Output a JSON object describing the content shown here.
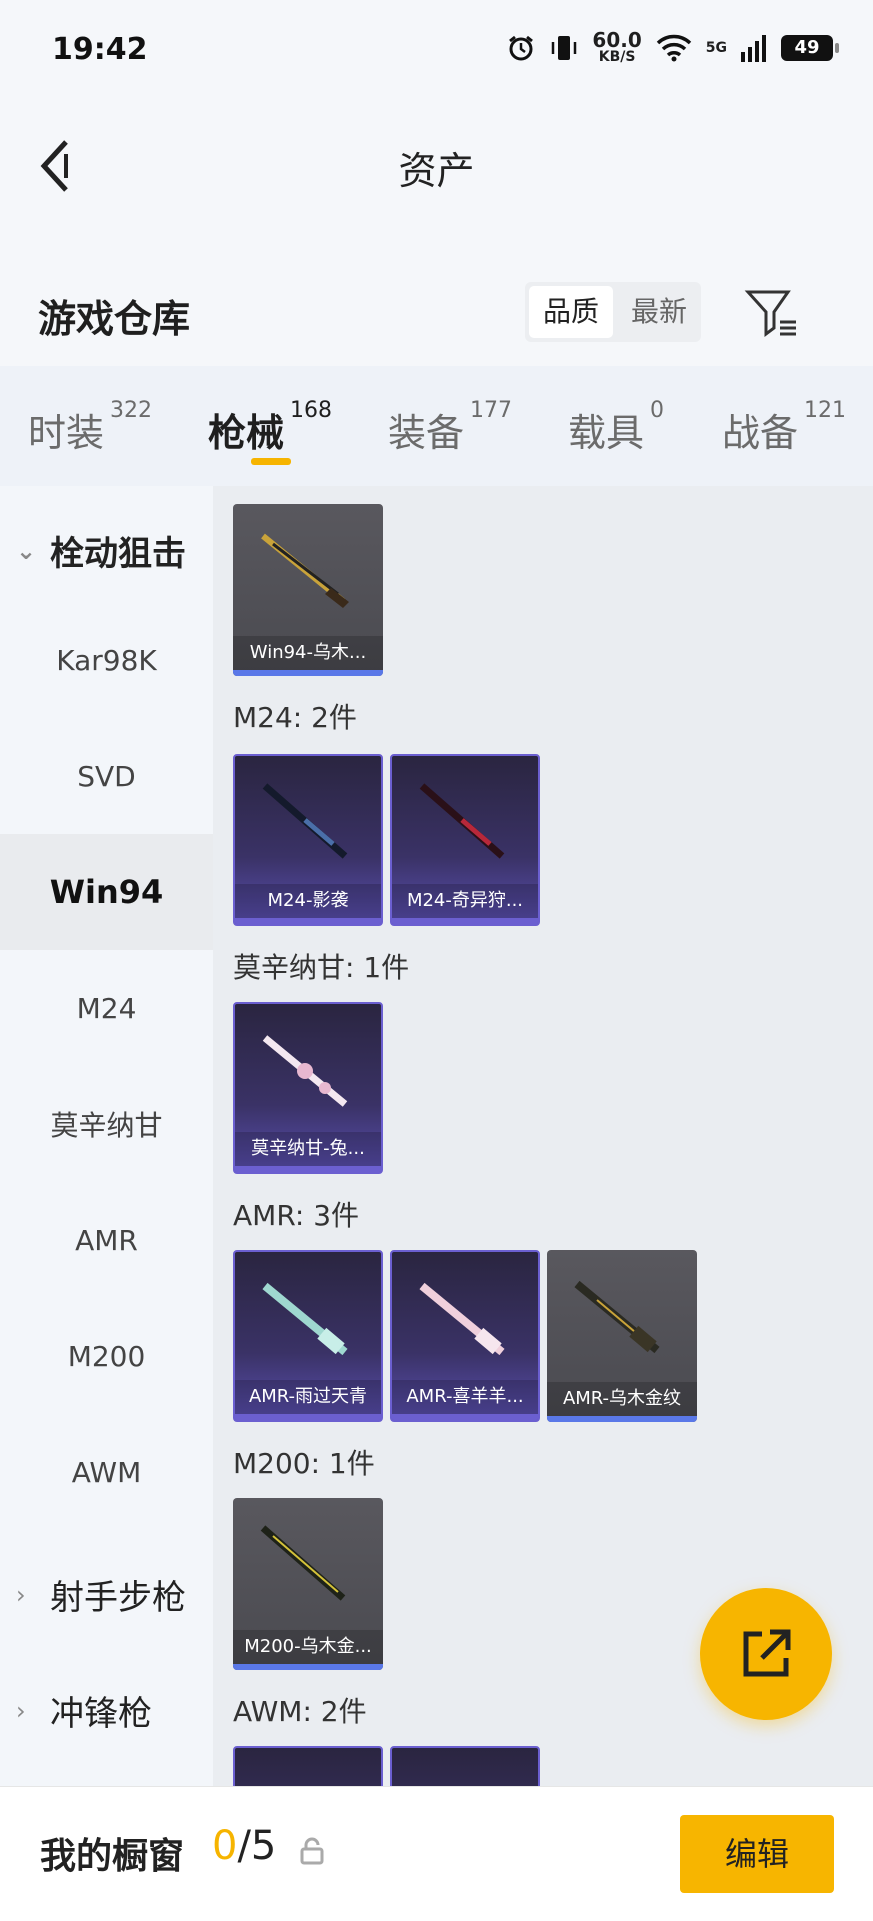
{
  "status": {
    "time": "19:42",
    "net_speed": "60.0",
    "net_unit": "KB/S",
    "signal": "5G",
    "battery": "49"
  },
  "nav": {
    "title": "资产"
  },
  "section": {
    "title": "游戏仓库",
    "sort_quality": "品质",
    "sort_newest": "最新"
  },
  "tabs": [
    {
      "label": "时装",
      "count": "322"
    },
    {
      "label": "枪械",
      "count": "168"
    },
    {
      "label": "装备",
      "count": "177"
    },
    {
      "label": "载具",
      "count": "0"
    },
    {
      "label": "战备",
      "count": "121"
    }
  ],
  "sidebar": {
    "group_open": "栓动狙击",
    "items": [
      "Kar98K",
      "SVD",
      "Win94",
      "M24",
      "莫辛纳甘",
      "AMR",
      "M200",
      "AWM"
    ],
    "group2": "射手步枪",
    "group3": "冲锋枪"
  },
  "content": {
    "win94_cards": [
      "Win94-乌木..."
    ],
    "m24_label": "M24: 2件",
    "m24_cards": [
      "M24-影袭",
      "M24-奇异狩..."
    ],
    "mosin_label": "莫辛纳甘: 1件",
    "mosin_cards": [
      "莫辛纳甘-兔..."
    ],
    "amr_label": "AMR: 3件",
    "amr_cards": [
      "AMR-雨过天青",
      "AMR-喜羊羊...",
      "AMR-乌木金纹"
    ],
    "m200_label": "M200: 1件",
    "m200_cards": [
      "M200-乌木金..."
    ],
    "awm_label": "AWM: 2件"
  },
  "bottom": {
    "label": "我的橱窗",
    "current": "0",
    "total": "/5",
    "edit": "编辑"
  }
}
